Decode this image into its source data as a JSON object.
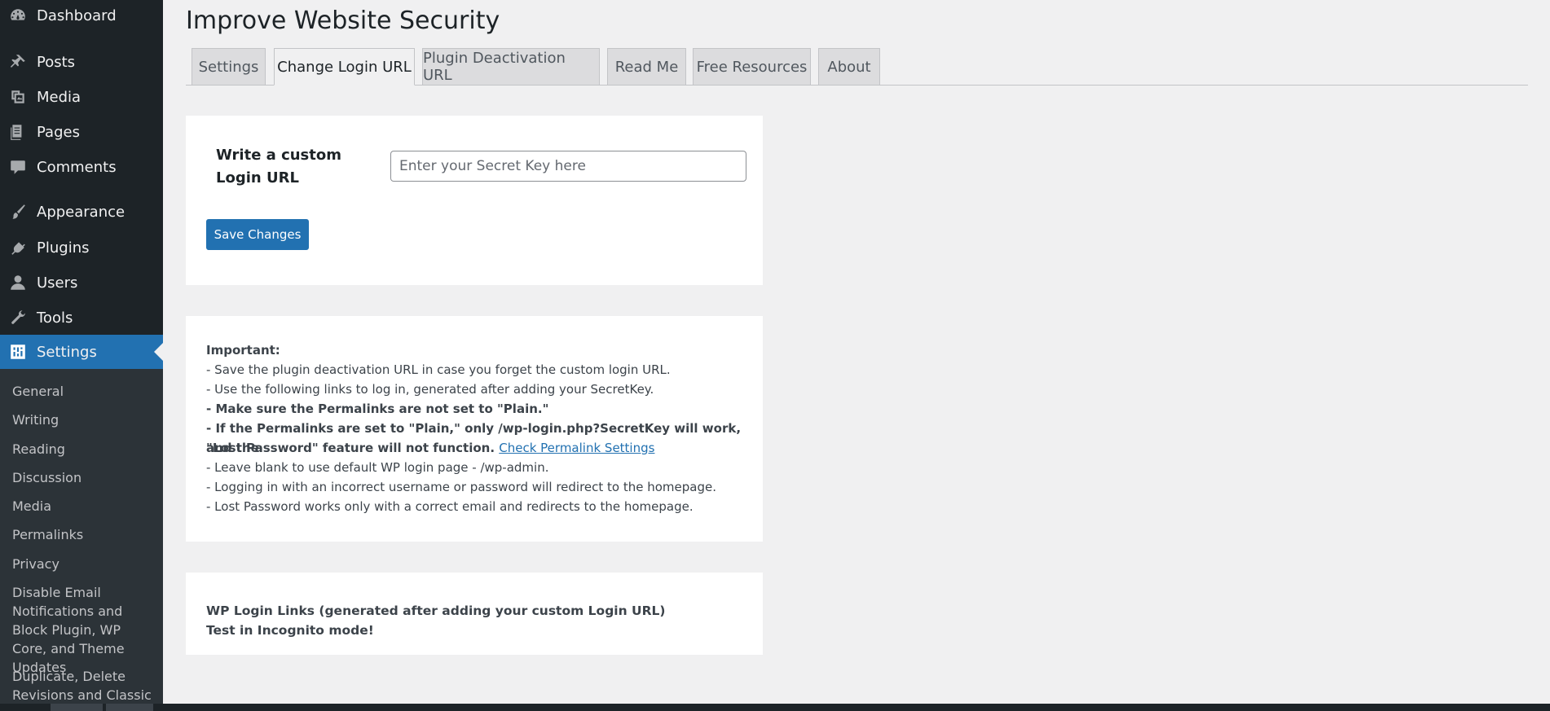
{
  "sidebar": {
    "items": [
      {
        "label": "Dashboard",
        "icon": "dashboard-icon"
      },
      {
        "label": "Posts",
        "icon": "pushpin-icon"
      },
      {
        "label": "Media",
        "icon": "media-icon"
      },
      {
        "label": "Pages",
        "icon": "pages-icon"
      },
      {
        "label": "Comments",
        "icon": "comment-icon"
      },
      {
        "label": "Appearance",
        "icon": "brush-icon"
      },
      {
        "label": "Plugins",
        "icon": "plugin-icon"
      },
      {
        "label": "Users",
        "icon": "user-icon"
      },
      {
        "label": "Tools",
        "icon": "wrench-icon"
      },
      {
        "label": "Settings",
        "icon": "settings-icon",
        "current": true
      }
    ],
    "submenu": [
      "General",
      "Writing",
      "Reading",
      "Discussion",
      "Media",
      "Permalinks",
      "Privacy",
      "Disable Email Notifications and Block Plugin, WP Core, and Theme Updates",
      "Duplicate, Delete Revisions and Classic"
    ]
  },
  "main": {
    "title": "Improve Website Security",
    "tabs": [
      {
        "label": "Settings",
        "active": false
      },
      {
        "label": "Change Login URL",
        "active": true
      },
      {
        "label": "Plugin Deactivation URL",
        "active": false
      },
      {
        "label": "Read Me",
        "active": false
      },
      {
        "label": "Free Resources",
        "active": false
      },
      {
        "label": "About",
        "active": false
      }
    ],
    "form": {
      "label": "Write a custom Login URL",
      "input_value": "",
      "input_placeholder": "Enter your Secret Key here",
      "save_label": "Save Changes"
    },
    "info": {
      "heading": "Important:",
      "line1": "- Save the plugin deactivation URL in case you forget the custom login URL.",
      "line2": "- Use the following links to log in, generated after adding your SecretKey.",
      "line3": "- Make sure the Permalinks are not set to \"Plain.\"",
      "line4a": "- If the Permalinks are set to \"Plain,\" only /wp-login.php?SecretKey will work, and the",
      "line4b": "\"Lost Password\" feature will not function.",
      "link": "Check Permalink Settings",
      "line5": "- Leave blank to use default WP login page - /wp-admin.",
      "line6": "- Logging in with an incorrect username or password will redirect to the homepage.",
      "line7": "- Lost Password works only with a correct email and redirects to the homepage."
    },
    "links_box": {
      "line1": "WP Login Links (generated after adding your custom Login URL)",
      "line2": "Test in Incognito mode!"
    }
  },
  "colors": {
    "sidebar_bg": "#1d2327",
    "submenu_bg": "#2c3338",
    "accent": "#2271b1",
    "page_bg": "#f0f0f1"
  }
}
